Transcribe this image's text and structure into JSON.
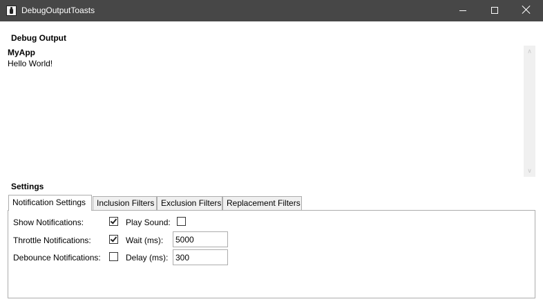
{
  "window": {
    "title": "DebugOutputToasts",
    "controls": [
      "minimize",
      "maximize",
      "close"
    ],
    "titlebar_color": "#474747"
  },
  "debug_output": {
    "heading": "Debug Output",
    "entries": [
      {
        "app": "MyApp",
        "message": "Hello World!"
      }
    ]
  },
  "settings": {
    "heading": "Settings",
    "tabs": [
      {
        "label": "Notification Settings",
        "active": true
      },
      {
        "label": "Inclusion Filters",
        "active": false
      },
      {
        "label": "Exclusion Filters",
        "active": false
      },
      {
        "label": "Replacement Filters",
        "active": false
      }
    ],
    "notification": {
      "show_notifications": {
        "label": "Show Notifications:",
        "checked": true
      },
      "play_sound": {
        "label": "Play Sound:",
        "checked": false
      },
      "throttle_notifications": {
        "label": "Throttle Notifications:",
        "checked": true
      },
      "wait": {
        "label": "Wait (ms):",
        "value": "5000"
      },
      "debounce_notifications": {
        "label": "Debounce Notifications:",
        "checked": false
      },
      "delay": {
        "label": "Delay (ms):",
        "value": "300"
      }
    }
  }
}
